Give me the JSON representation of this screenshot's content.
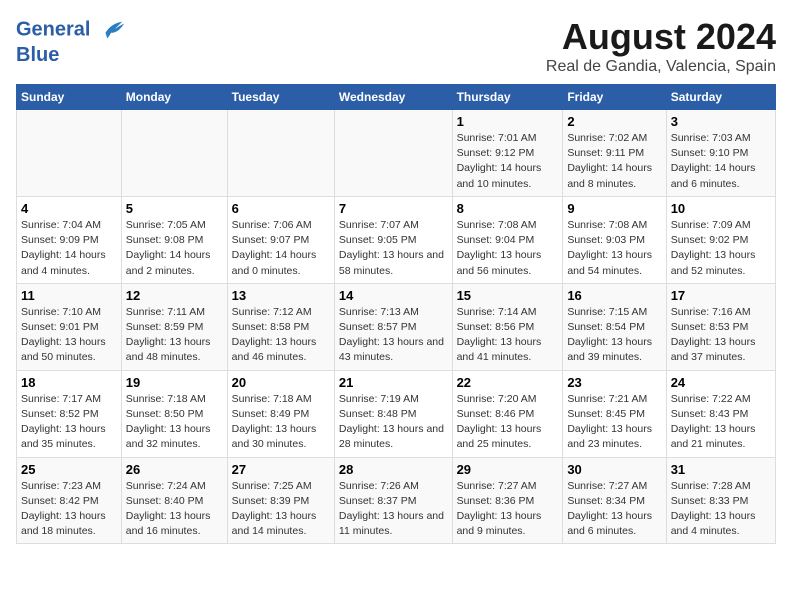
{
  "header": {
    "logo_line1": "General",
    "logo_line2": "Blue",
    "main_title": "August 2024",
    "subtitle": "Real de Gandia, Valencia, Spain"
  },
  "days_of_week": [
    "Sunday",
    "Monday",
    "Tuesday",
    "Wednesday",
    "Thursday",
    "Friday",
    "Saturday"
  ],
  "weeks": [
    [
      {
        "day": "",
        "sunrise": "",
        "sunset": "",
        "daylight": ""
      },
      {
        "day": "",
        "sunrise": "",
        "sunset": "",
        "daylight": ""
      },
      {
        "day": "",
        "sunrise": "",
        "sunset": "",
        "daylight": ""
      },
      {
        "day": "",
        "sunrise": "",
        "sunset": "",
        "daylight": ""
      },
      {
        "day": "1",
        "sunrise": "Sunrise: 7:01 AM",
        "sunset": "Sunset: 9:12 PM",
        "daylight": "Daylight: 14 hours and 10 minutes."
      },
      {
        "day": "2",
        "sunrise": "Sunrise: 7:02 AM",
        "sunset": "Sunset: 9:11 PM",
        "daylight": "Daylight: 14 hours and 8 minutes."
      },
      {
        "day": "3",
        "sunrise": "Sunrise: 7:03 AM",
        "sunset": "Sunset: 9:10 PM",
        "daylight": "Daylight: 14 hours and 6 minutes."
      }
    ],
    [
      {
        "day": "4",
        "sunrise": "Sunrise: 7:04 AM",
        "sunset": "Sunset: 9:09 PM",
        "daylight": "Daylight: 14 hours and 4 minutes."
      },
      {
        "day": "5",
        "sunrise": "Sunrise: 7:05 AM",
        "sunset": "Sunset: 9:08 PM",
        "daylight": "Daylight: 14 hours and 2 minutes."
      },
      {
        "day": "6",
        "sunrise": "Sunrise: 7:06 AM",
        "sunset": "Sunset: 9:07 PM",
        "daylight": "Daylight: 14 hours and 0 minutes."
      },
      {
        "day": "7",
        "sunrise": "Sunrise: 7:07 AM",
        "sunset": "Sunset: 9:05 PM",
        "daylight": "Daylight: 13 hours and 58 minutes."
      },
      {
        "day": "8",
        "sunrise": "Sunrise: 7:08 AM",
        "sunset": "Sunset: 9:04 PM",
        "daylight": "Daylight: 13 hours and 56 minutes."
      },
      {
        "day": "9",
        "sunrise": "Sunrise: 7:08 AM",
        "sunset": "Sunset: 9:03 PM",
        "daylight": "Daylight: 13 hours and 54 minutes."
      },
      {
        "day": "10",
        "sunrise": "Sunrise: 7:09 AM",
        "sunset": "Sunset: 9:02 PM",
        "daylight": "Daylight: 13 hours and 52 minutes."
      }
    ],
    [
      {
        "day": "11",
        "sunrise": "Sunrise: 7:10 AM",
        "sunset": "Sunset: 9:01 PM",
        "daylight": "Daylight: 13 hours and 50 minutes."
      },
      {
        "day": "12",
        "sunrise": "Sunrise: 7:11 AM",
        "sunset": "Sunset: 8:59 PM",
        "daylight": "Daylight: 13 hours and 48 minutes."
      },
      {
        "day": "13",
        "sunrise": "Sunrise: 7:12 AM",
        "sunset": "Sunset: 8:58 PM",
        "daylight": "Daylight: 13 hours and 46 minutes."
      },
      {
        "day": "14",
        "sunrise": "Sunrise: 7:13 AM",
        "sunset": "Sunset: 8:57 PM",
        "daylight": "Daylight: 13 hours and 43 minutes."
      },
      {
        "day": "15",
        "sunrise": "Sunrise: 7:14 AM",
        "sunset": "Sunset: 8:56 PM",
        "daylight": "Daylight: 13 hours and 41 minutes."
      },
      {
        "day": "16",
        "sunrise": "Sunrise: 7:15 AM",
        "sunset": "Sunset: 8:54 PM",
        "daylight": "Daylight: 13 hours and 39 minutes."
      },
      {
        "day": "17",
        "sunrise": "Sunrise: 7:16 AM",
        "sunset": "Sunset: 8:53 PM",
        "daylight": "Daylight: 13 hours and 37 minutes."
      }
    ],
    [
      {
        "day": "18",
        "sunrise": "Sunrise: 7:17 AM",
        "sunset": "Sunset: 8:52 PM",
        "daylight": "Daylight: 13 hours and 35 minutes."
      },
      {
        "day": "19",
        "sunrise": "Sunrise: 7:18 AM",
        "sunset": "Sunset: 8:50 PM",
        "daylight": "Daylight: 13 hours and 32 minutes."
      },
      {
        "day": "20",
        "sunrise": "Sunrise: 7:18 AM",
        "sunset": "Sunset: 8:49 PM",
        "daylight": "Daylight: 13 hours and 30 minutes."
      },
      {
        "day": "21",
        "sunrise": "Sunrise: 7:19 AM",
        "sunset": "Sunset: 8:48 PM",
        "daylight": "Daylight: 13 hours and 28 minutes."
      },
      {
        "day": "22",
        "sunrise": "Sunrise: 7:20 AM",
        "sunset": "Sunset: 8:46 PM",
        "daylight": "Daylight: 13 hours and 25 minutes."
      },
      {
        "day": "23",
        "sunrise": "Sunrise: 7:21 AM",
        "sunset": "Sunset: 8:45 PM",
        "daylight": "Daylight: 13 hours and 23 minutes."
      },
      {
        "day": "24",
        "sunrise": "Sunrise: 7:22 AM",
        "sunset": "Sunset: 8:43 PM",
        "daylight": "Daylight: 13 hours and 21 minutes."
      }
    ],
    [
      {
        "day": "25",
        "sunrise": "Sunrise: 7:23 AM",
        "sunset": "Sunset: 8:42 PM",
        "daylight": "Daylight: 13 hours and 18 minutes."
      },
      {
        "day": "26",
        "sunrise": "Sunrise: 7:24 AM",
        "sunset": "Sunset: 8:40 PM",
        "daylight": "Daylight: 13 hours and 16 minutes."
      },
      {
        "day": "27",
        "sunrise": "Sunrise: 7:25 AM",
        "sunset": "Sunset: 8:39 PM",
        "daylight": "Daylight: 13 hours and 14 minutes."
      },
      {
        "day": "28",
        "sunrise": "Sunrise: 7:26 AM",
        "sunset": "Sunset: 8:37 PM",
        "daylight": "Daylight: 13 hours and 11 minutes."
      },
      {
        "day": "29",
        "sunrise": "Sunrise: 7:27 AM",
        "sunset": "Sunset: 8:36 PM",
        "daylight": "Daylight: 13 hours and 9 minutes."
      },
      {
        "day": "30",
        "sunrise": "Sunrise: 7:27 AM",
        "sunset": "Sunset: 8:34 PM",
        "daylight": "Daylight: 13 hours and 6 minutes."
      },
      {
        "day": "31",
        "sunrise": "Sunrise: 7:28 AM",
        "sunset": "Sunset: 8:33 PM",
        "daylight": "Daylight: 13 hours and 4 minutes."
      }
    ]
  ]
}
